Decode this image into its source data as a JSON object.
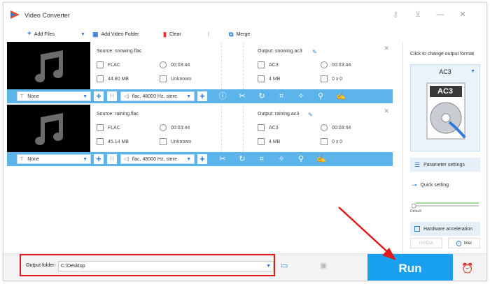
{
  "app": {
    "title": "Video Converter"
  },
  "toolbar": {
    "add_files": "Add Files",
    "add_video_folder": "Add Video Folder",
    "clear": "Clear",
    "merge": "Merge"
  },
  "items": [
    {
      "source": "Source: snowing.flac",
      "src_format": "FLAC",
      "src_duration": "00:03:44",
      "src_size": "44.80 MB",
      "src_resolution": "Unknown",
      "output": "Output: snowing.ac3",
      "out_format": "AC3",
      "out_duration": "00:03:44",
      "out_size": "4 MB",
      "out_resolution": "0 x 0",
      "subtitle": "None",
      "audio": "flac, 48000 Hz, stere"
    },
    {
      "source": "Source: raining.flac",
      "src_format": "FLAC",
      "src_duration": "00:03:44",
      "src_size": "45.14 MB",
      "src_resolution": "Unknown",
      "output": "Output: raining.ac3",
      "out_format": "AC3",
      "out_duration": "00:03:44",
      "out_size": "4 MB",
      "out_resolution": "0 x 0",
      "subtitle": "None",
      "audio": "flac, 48000 Hz, stere"
    }
  ],
  "right_panel": {
    "change_format_label": "Click to change output format",
    "format": "AC3",
    "disc_label": "AC3",
    "parameter_settings": "Parameter settings",
    "quick_setting": "Quick setting",
    "default_label": "Default",
    "hardware_acceleration": "Hardware acceleration",
    "nvidia": "NVIDIA",
    "intel": "Intel"
  },
  "bottom": {
    "output_folder_label": "Output folder:",
    "output_path": "C:\\Desktop",
    "run_label": "Run"
  },
  "colors": {
    "accent": "#1aa0f0",
    "control_bar": "#5cb4ea",
    "annotation": "#e11b1b"
  }
}
